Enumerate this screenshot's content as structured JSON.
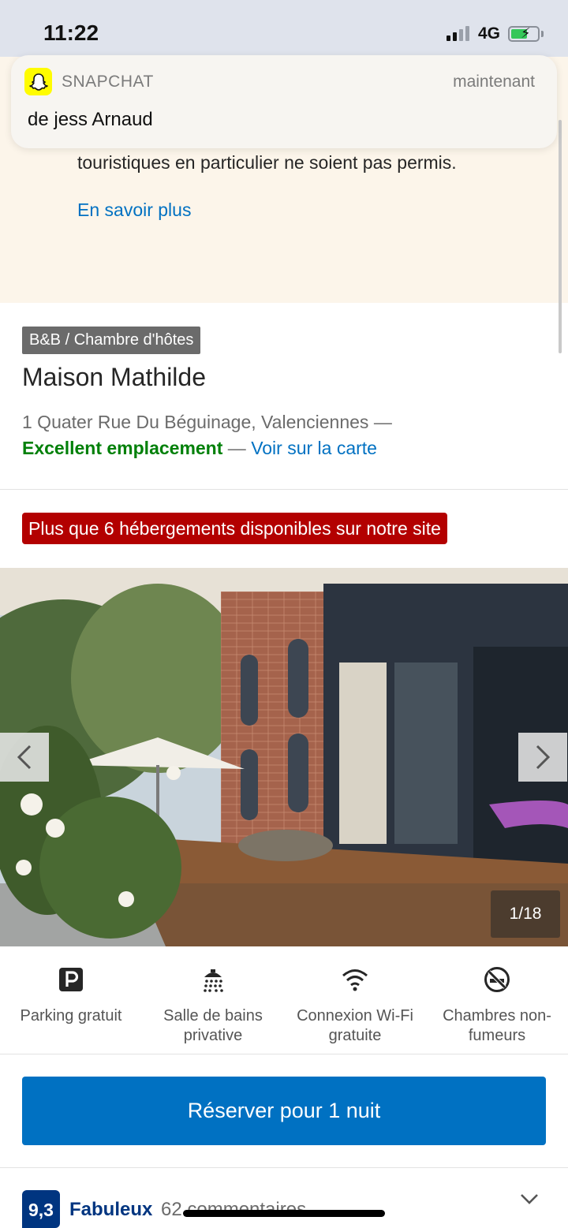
{
  "status_bar": {
    "time": "11:22",
    "network": "4G"
  },
  "notification": {
    "app": "SNAPCHAT",
    "time": "maintenant",
    "body": "de jess Arnaud"
  },
  "notice": {
    "text": "déplacements soient autorisés seulement dans certaines circonstances et que les voyages touristiques en particulier ne soient pas permis.",
    "link": "En savoir plus"
  },
  "property": {
    "type_badge": "B&B / Chambre d'hôtes",
    "name": "Maison Mathilde",
    "address": "1 Quater Rue Du Béguinage, Valenciennes —",
    "location_rating": "Excellent emplacement",
    "separator": "—",
    "map_link": "Voir sur la carte",
    "urgency": "Plus que 6 hébergements disponibles sur notre site"
  },
  "gallery": {
    "counter": "1/18"
  },
  "amenities": [
    {
      "icon": "parking-icon",
      "label": "Parking gratuit"
    },
    {
      "icon": "shower-icon",
      "label": "Salle de bains privative"
    },
    {
      "icon": "wifi-icon",
      "label": "Connexion Wi-Fi gratuite"
    },
    {
      "icon": "no-smoking-icon",
      "label": "Chambres non-fumeurs"
    }
  ],
  "reserve_label": "Réserver pour 1 nuit",
  "reviews": {
    "score": "9,3",
    "label": "Fabuleux",
    "count": "62 commentaires"
  },
  "colors": {
    "brand_blue": "#0071c2",
    "dark_blue": "#003580",
    "urgency_red": "#b30000",
    "good_green": "#008009",
    "notice_bg": "#fcf5ea"
  }
}
